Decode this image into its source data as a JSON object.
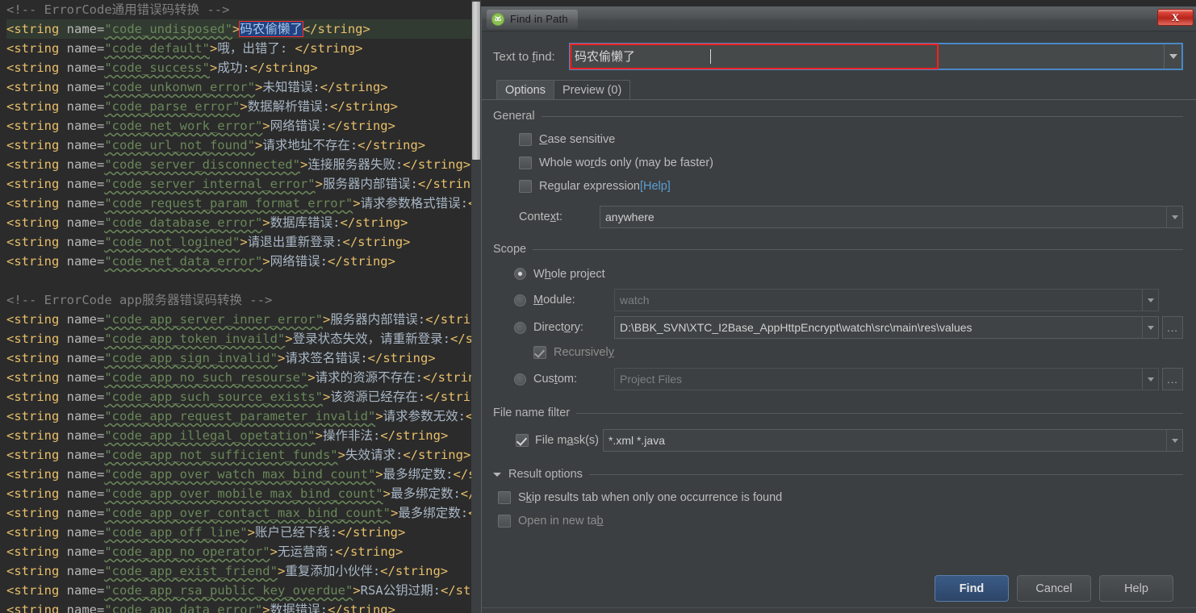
{
  "editor": {
    "lines": [
      {
        "type": "comment",
        "text": "<!-- ErrorCode通用错误码转换 -->"
      },
      {
        "type": "string_sel",
        "pre": "<string ",
        "attr": "name=",
        "val": "\"code_undisposed\"",
        "gt": ">",
        "sel": "码农偷懒了",
        "close": "</string>"
      },
      {
        "type": "string",
        "pre": "<string ",
        "attr": "name=",
        "val": "\"code_default\"",
        "gt": ">",
        "text": "哦，出错了: ",
        "close": "</string>"
      },
      {
        "type": "string",
        "pre": "<string ",
        "attr": "name=",
        "val": "\"code_success\"",
        "gt": ">",
        "text": "成功:",
        "close": "</string>"
      },
      {
        "type": "string",
        "pre": "<string ",
        "attr": "name=",
        "val": "\"code_unkonwn_error\"",
        "gt": ">",
        "text": "未知错误:",
        "close": "</string>"
      },
      {
        "type": "string",
        "pre": "<string ",
        "attr": "name=",
        "val": "\"code_parse_error\"",
        "gt": ">",
        "text": "数据解析错误:",
        "close": "</string>"
      },
      {
        "type": "string",
        "pre": "<string ",
        "attr": "name=",
        "val": "\"code_net_work_error\"",
        "gt": ">",
        "text": "网络错误:",
        "close": "</string>"
      },
      {
        "type": "string",
        "pre": "<string ",
        "attr": "name=",
        "val": "\"code_url_not_found\"",
        "gt": ">",
        "text": "请求地址不存在:",
        "close": "</string>"
      },
      {
        "type": "string",
        "pre": "<string ",
        "attr": "name=",
        "val": "\"code_server_disconnected\"",
        "gt": ">",
        "text": "连接服务器失败:",
        "close": "</string>"
      },
      {
        "type": "string",
        "pre": "<string ",
        "attr": "name=",
        "val": "\"code_server_internal_error\"",
        "gt": ">",
        "text": "服务器内部错误:",
        "close": "</string>"
      },
      {
        "type": "string",
        "pre": "<string ",
        "attr": "name=",
        "val": "\"code_request_param_format_error\"",
        "gt": ">",
        "text": "请求参数格式错误:",
        "close": "</string>"
      },
      {
        "type": "string",
        "pre": "<string ",
        "attr": "name=",
        "val": "\"code_database_error\"",
        "gt": ">",
        "text": "数据库错误:",
        "close": "</string>"
      },
      {
        "type": "string",
        "pre": "<string ",
        "attr": "name=",
        "val": "\"code_not_logined\"",
        "gt": ">",
        "text": "请退出重新登录:",
        "close": "</string>"
      },
      {
        "type": "string",
        "pre": "<string ",
        "attr": "name=",
        "val": "\"code_net_data_error\"",
        "gt": ">",
        "text": "网络错误:",
        "close": "</string>"
      },
      {
        "type": "blank",
        "text": ""
      },
      {
        "type": "comment",
        "text": "<!-- ErrorCode app服务器错误码转换 -->"
      },
      {
        "type": "string",
        "pre": "<string ",
        "attr": "name=",
        "val": "\"code_app_server_inner_error\"",
        "gt": ">",
        "text": "服务器内部错误:",
        "close": "</string>"
      },
      {
        "type": "string",
        "pre": "<string ",
        "attr": "name=",
        "val": "\"code_app_token_invaild\"",
        "gt": ">",
        "text": "登录状态失效，请重新登录:",
        "close": "</string>"
      },
      {
        "type": "string",
        "pre": "<string ",
        "attr": "name=",
        "val": "\"code_app_sign_invalid\"",
        "gt": ">",
        "text": "请求签名错误:",
        "close": "</string>"
      },
      {
        "type": "string",
        "pre": "<string ",
        "attr": "name=",
        "val": "\"code_app_no_such_resourse\"",
        "gt": ">",
        "text": "请求的资源不存在:",
        "close": "</string>"
      },
      {
        "type": "string",
        "pre": "<string ",
        "attr": "name=",
        "val": "\"code_app_such_source_exists\"",
        "gt": ">",
        "text": "该资源已经存在:",
        "close": "</string>"
      },
      {
        "type": "string",
        "pre": "<string ",
        "attr": "name=",
        "val": "\"code_app_request_parameter_invalid\"",
        "gt": ">",
        "text": "请求参数无效:",
        "close": "</string>"
      },
      {
        "type": "string",
        "pre": "<string ",
        "attr": "name=",
        "val": "\"code_app_illegal_opetation\"",
        "gt": ">",
        "text": "操作非法:",
        "close": "</string>"
      },
      {
        "type": "string",
        "pre": "<string ",
        "attr": "name=",
        "val": "\"code_app_not_sufficient_funds\"",
        "gt": ">",
        "text": "失效请求:",
        "close": "</string>"
      },
      {
        "type": "string",
        "pre": "<string ",
        "attr": "name=",
        "val": "\"code_app_over_watch_max_bind_count\"",
        "gt": ">",
        "text": "最多绑定数:",
        "close": "</string>"
      },
      {
        "type": "string",
        "pre": "<string ",
        "attr": "name=",
        "val": "\"code_app_over_mobile_max_bind_count\"",
        "gt": ">",
        "text": "最多绑定数:",
        "close": "</string>"
      },
      {
        "type": "string",
        "pre": "<string ",
        "attr": "name=",
        "val": "\"code_app_over_contact_max_bind_count\"",
        "gt": ">",
        "text": "最多绑定数:",
        "close": "</string>"
      },
      {
        "type": "string",
        "pre": "<string ",
        "attr": "name=",
        "val": "\"code_app_off_line\"",
        "gt": ">",
        "text": "账户已经下线:",
        "close": "</string>"
      },
      {
        "type": "string",
        "pre": "<string ",
        "attr": "name=",
        "val": "\"code_app_no_operator\"",
        "gt": ">",
        "text": "无运营商:",
        "close": "</string>"
      },
      {
        "type": "string",
        "pre": "<string ",
        "attr": "name=",
        "val": "\"code_app_exist_friend\"",
        "gt": ">",
        "text": "重复添加小伙伴:",
        "close": "</string>"
      },
      {
        "type": "string",
        "pre": "<string ",
        "attr": "name=",
        "val": "\"code_app_rsa_public_key_overdue\"",
        "gt": ">",
        "text": "RSA公钥过期:",
        "close": "</string>"
      },
      {
        "type": "string",
        "pre": "<string ",
        "attr": "name=",
        "val": "\"code_app_data_error\"",
        "gt": ">",
        "text": "数据错误:",
        "close": "</string>"
      }
    ],
    "colors": {
      "background": "#2b2b2b",
      "comment": "#808080",
      "tag": "#e8bf6a",
      "attribute_value": "#6a8759",
      "text": "#a9b7c6",
      "selection": "#214283",
      "selection_outline": "#ff2b2b",
      "current_line": "#323b32"
    }
  },
  "dialog": {
    "title": "Find in Path",
    "close_label": "X",
    "find": {
      "label": "Text to find:",
      "label_mnemonic": "f",
      "value": "码农偷懒了",
      "placeholder": ""
    },
    "tabs": [
      {
        "label": "Options",
        "active": true
      },
      {
        "label": "Preview (0)",
        "active": false
      }
    ],
    "general": {
      "title": "General",
      "checkboxes": [
        {
          "label": "Case sensitive",
          "checked": false,
          "mnemonic": "C"
        },
        {
          "label": "Whole words only (may be faster)",
          "checked": false,
          "mnemonic": "r"
        },
        {
          "label": "Regular expression",
          "checked": false,
          "mnemonic": "g",
          "link": "[Help]"
        }
      ],
      "context": {
        "label": "Context:",
        "value": "anywhere"
      }
    },
    "scope": {
      "title": "Scope",
      "options": [
        {
          "id": "whole-project",
          "label": "Whole project",
          "selected": true
        },
        {
          "id": "module",
          "label": "Module:",
          "selected": false,
          "value": "watch",
          "disabled": true
        },
        {
          "id": "directory",
          "label": "Directory:",
          "selected": false,
          "value": "D:\\BBK_SVN\\XTC_I2Base_AppHttpEncrypt\\watch\\src\\main\\res\\values",
          "disabled": false,
          "has_browse": true
        },
        {
          "id": "custom",
          "label": "Custom:",
          "selected": false,
          "value": "Project Files",
          "disabled": true,
          "has_browse": true
        }
      ],
      "recursively": {
        "label": "Recursively",
        "checked": true,
        "disabled": true
      }
    },
    "file_filter": {
      "title": "File name filter",
      "mask": {
        "label": "File mask(s)",
        "checked": true,
        "value": "*.xml *.java"
      }
    },
    "result_options": {
      "title": "Result options",
      "expanded": true,
      "checkboxes": [
        {
          "label": "Skip results tab when only one occurrence is found",
          "checked": false,
          "disabled": false
        },
        {
          "label": "Open in new tab",
          "checked": false,
          "disabled": true
        }
      ]
    },
    "buttons": [
      {
        "label": "Find",
        "primary": true
      },
      {
        "label": "Cancel",
        "primary": false
      },
      {
        "label": "Help",
        "primary": false
      }
    ],
    "colors": {
      "background": "#3c3f41",
      "accent": "#4a88c7",
      "error_outline": "#ff2020",
      "link": "#5a9fd4",
      "primary_button": "#3a5b86",
      "close_button": "#c0392b"
    }
  }
}
